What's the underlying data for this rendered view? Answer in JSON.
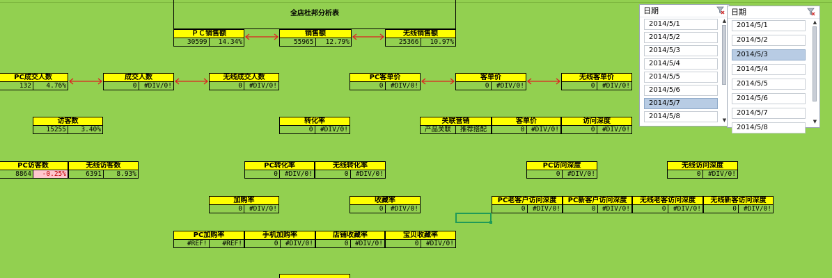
{
  "title": "全店杜邦分析表",
  "metrics": {
    "pc_sales": {
      "label": "ＰＣ销售额",
      "v1": "30599",
      "v2": "14.34%"
    },
    "sales": {
      "label": "销售额",
      "v1": "55965",
      "v2": "12.79%"
    },
    "wireless_sales": {
      "label": "无线销售额",
      "v1": "25366",
      "v2": "10.97%"
    },
    "pc_buyers": {
      "label": "PC成交人数",
      "v1": "132",
      "v2": "4.76%"
    },
    "buyers": {
      "label": "成交人数",
      "v1": "0",
      "v2": "#DIV/0!"
    },
    "wireless_buyers": {
      "label": "无线成交人数",
      "v1": "0",
      "v2": "#DIV/0!"
    },
    "pc_avg_order": {
      "label": "PC客单价",
      "v1": "0",
      "v2": "#DIV/0!"
    },
    "avg_order": {
      "label": "客单价",
      "v1": "0",
      "v2": "#DIV/0!"
    },
    "wireless_avg_order": {
      "label": "无线客单价",
      "v1": "0",
      "v2": "#DIV/0!"
    },
    "visitors": {
      "label": "访客数",
      "v1": "15255",
      "v2": "3.40%"
    },
    "conversion": {
      "label": "转化率",
      "v1": "0",
      "v2": "#DIV/0!"
    },
    "related": {
      "label": "关联营销",
      "v1": "产品关联",
      "v2": "推荐搭配"
    },
    "avg_order2": {
      "label": "客单价",
      "v1": "0",
      "v2": "#DIV/0!"
    },
    "visit_depth": {
      "label": "访问深度",
      "v1": "0",
      "v2": "#DIV/0!"
    },
    "pc_visitors": {
      "label": "PC访客数",
      "v1": "8864",
      "v2": "-0.25%"
    },
    "wireless_visitors": {
      "label": "无线访客数",
      "v1": "6391",
      "v2": "8.93%"
    },
    "pc_conversion": {
      "label": "PC转化率",
      "v1": "0",
      "v2": "#DIV/0!"
    },
    "wireless_conversion": {
      "label": "无线转化率",
      "v1": "0",
      "v2": "#DIV/0!"
    },
    "pc_visit_depth": {
      "label": "PC访问深度",
      "v1": "0",
      "v2": "#DIV/0!"
    },
    "wireless_visit_depth": {
      "label": "无线访问深度",
      "v1": "0",
      "v2": "#DIV/0!"
    },
    "add_cart": {
      "label": "加购率",
      "v1": "0",
      "v2": "#DIV/0!"
    },
    "favorite": {
      "label": "收藏率",
      "v1": "0",
      "v2": "#DIV/0!"
    },
    "pc_old_depth": {
      "label": "PC老客户访问深度",
      "v1": "0",
      "v2": "#DIV/0!"
    },
    "pc_new_depth": {
      "label": "PC新客户访问深度",
      "v1": "0",
      "v2": "#DIV/0!"
    },
    "wl_old_depth": {
      "label": "无线老客访问深度",
      "v1": "0",
      "v2": "#DIV/0!"
    },
    "wl_new_depth": {
      "label": "无线新客访问深度",
      "v1": "0",
      "v2": "#DIV/0!"
    },
    "pc_add_cart": {
      "label": "PC加购率",
      "v1": "#REF!",
      "v2": "#REF!"
    },
    "mobile_add_cart": {
      "label": "手机加购率",
      "v1": "0",
      "v2": "#DIV/0!"
    },
    "shop_favorite": {
      "label": "店铺收藏率",
      "v1": "0",
      "v2": "#DIV/0!"
    },
    "item_favorite": {
      "label": "宝贝收藏率",
      "v1": "0",
      "v2": "#DIV/0!"
    }
  },
  "slicer1": {
    "header": "日期",
    "items": [
      "2014/5/1",
      "2014/5/2",
      "2014/5/3",
      "2014/5/4",
      "2014/5/5",
      "2014/5/6",
      "2014/5/7",
      "2014/5/8"
    ],
    "selected": "2014/5/7"
  },
  "slicer2": {
    "header": "日期",
    "items": [
      "2014/5/1",
      "2014/5/2",
      "2014/5/3",
      "2014/5/4",
      "2014/5/5",
      "2014/5/6",
      "2014/5/7",
      "2014/5/8"
    ],
    "selected": "2014/5/3"
  },
  "colors": {
    "background": "#92d050",
    "header": "#ffff00",
    "arrow": "#e02020",
    "negative_bg": "#ffc7ce",
    "slicer_selected": "#b8cce4"
  },
  "icons": {
    "filter_clear": "filter-clear-icon",
    "arrow": "double-arrow-icon"
  }
}
